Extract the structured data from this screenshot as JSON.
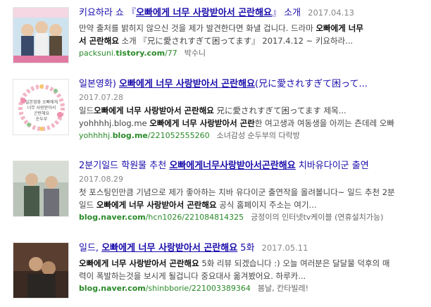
{
  "results": [
    {
      "title_pre": "키요하라 쇼 『",
      "title_bold": "오빠에게 너무 사랑받아서 곤란해요",
      "title_post": "』 소개",
      "date": "2017.04.13",
      "snippet1_pre": "만약 출처를 밝히지 않으신 것을 제가 발견한다면 화낼 겁니다. 드라마 ",
      "snippet1_bold": "오빠에게 너무",
      "snippet2_bold": "서 곤란해요",
      "snippet2_post": " 소개 『兄に愛されすぎて困ってます』 2017.4.12 ~ 키요하라...",
      "src_pre": "packsuni.",
      "src_dom": "tistory.com",
      "src_path": "/77",
      "author": "박수니"
    },
    {
      "title_pre": "일본영화) ",
      "title_bold": "오빠에게 너무 사랑받아서 곤란해요",
      "title_post": "(兄に愛されすぎて困って...",
      "date": "2017.07.28",
      "snippet1_pre": "일드",
      "snippet1_bold": "오빠에게 너무 사랑받아서 곤란해요",
      "snippet1_post": " 兄に愛されすぎて困ってます 제목...",
      "snippet2_pre": "yohhhhj.blog.me ",
      "snippet2_bold": "오빠에게 너무 사랑받아서 곤란",
      "snippet2_post": "한 여고생과 여동생을 아끼는 츤데레 오빠",
      "src_pre": "yohhhhj.",
      "src_dom": "blog.me",
      "src_path": "/221052555260",
      "author": "소녀감성 순두부의 다락방"
    },
    {
      "title_pre": "2분기일드 학원물 추천 ",
      "title_bold": "오빠에게너무사랑받아서곤란해요",
      "title_post": " 치바유다이군 출연",
      "date": "2017.08.29",
      "snippet1_pre": "첫 포스팅인만큼 기념으로 제가 좋아하는 치바 유다이군 출연작을 올려볼니다~ 일드 추천 2분",
      "snippet2_pre": "일드 ",
      "snippet2_bold": "오빠에게 너무 사랑받아서 곤란해요",
      "snippet2_post": " 공식 홈페이지 주소는 여기...",
      "src_pre": "",
      "src_dom": "blog.naver.com",
      "src_path": "/hcn1026/221084814325",
      "author": "긍정이의 인터넷tv케이블 (연휴설치가능)"
    },
    {
      "title_pre": "일드, ",
      "title_bold": "오빠에게 너무 사랑받아서 곤란해요",
      "title_post": " 5화",
      "date": "2017.05.11",
      "snippet1_pre": "",
      "snippet1_bold": "오빠에게 너무 사랑받아서 곤란해요",
      "snippet1_post": " 5화 리뷰 되겠습니다 :) 오늘 여러분은 달달물 덕후의 매",
      "snippet2_pre": "력이 폭발하는것을 보시게 될겁니다 중요대사 옮겨봤어요. 하루카...",
      "src_pre": "",
      "src_dom": "blog.naver.com",
      "src_path": "/shinbborie/221003389364",
      "author": "봄날, 칸타빌레!"
    }
  ],
  "thumbs": [
    {
      "name": "drama-poster-thumbnail"
    },
    {
      "name": "wreath-illustration-thumbnail",
      "text1": "일본영화 오빠에게",
      "text2": "너무 사랑받아서",
      "text3": "곤란해요",
      "text4": "순두부"
    },
    {
      "name": "actors-photo-thumbnail"
    },
    {
      "name": "drama-scene-thumbnail"
    }
  ]
}
